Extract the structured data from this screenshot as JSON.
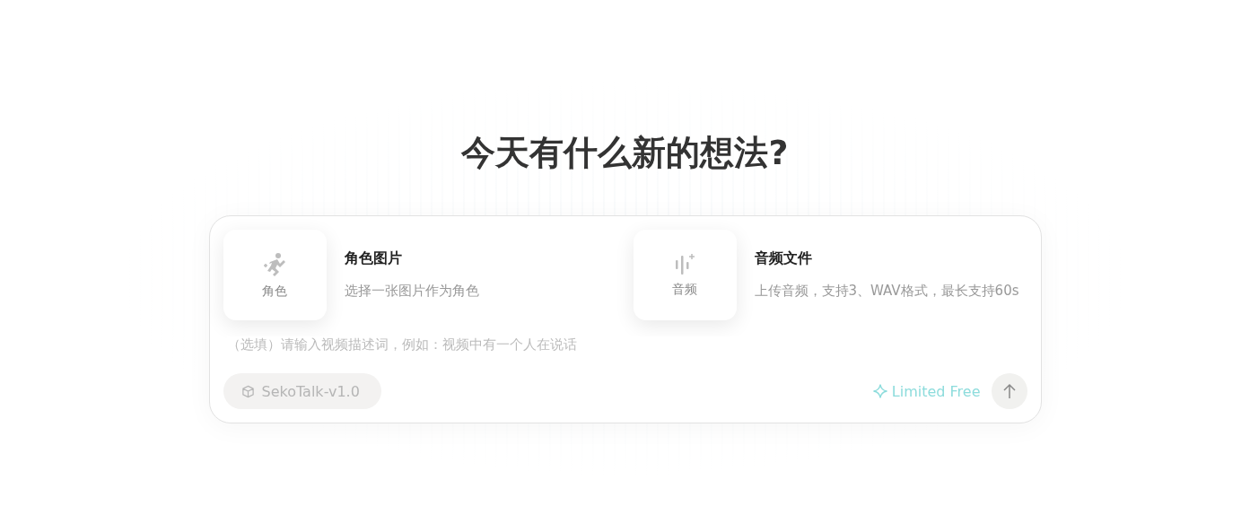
{
  "heading": "今天有什么新的想法?",
  "uploads": [
    {
      "kind": "character",
      "tile_label": "角色",
      "title": "角色图片",
      "description": "选择一张图片作为角色"
    },
    {
      "kind": "audio",
      "tile_label": "音频",
      "title": "音频文件",
      "description": "上传音频，支持3、WAV格式，最长支持60s"
    }
  ],
  "prompt": {
    "placeholder": "（选填）请输入视频描述词，例如：视频中有一个人在说话"
  },
  "model": {
    "label": "SekoTalk-v1.0"
  },
  "badge": {
    "label": "Limited Free"
  }
}
